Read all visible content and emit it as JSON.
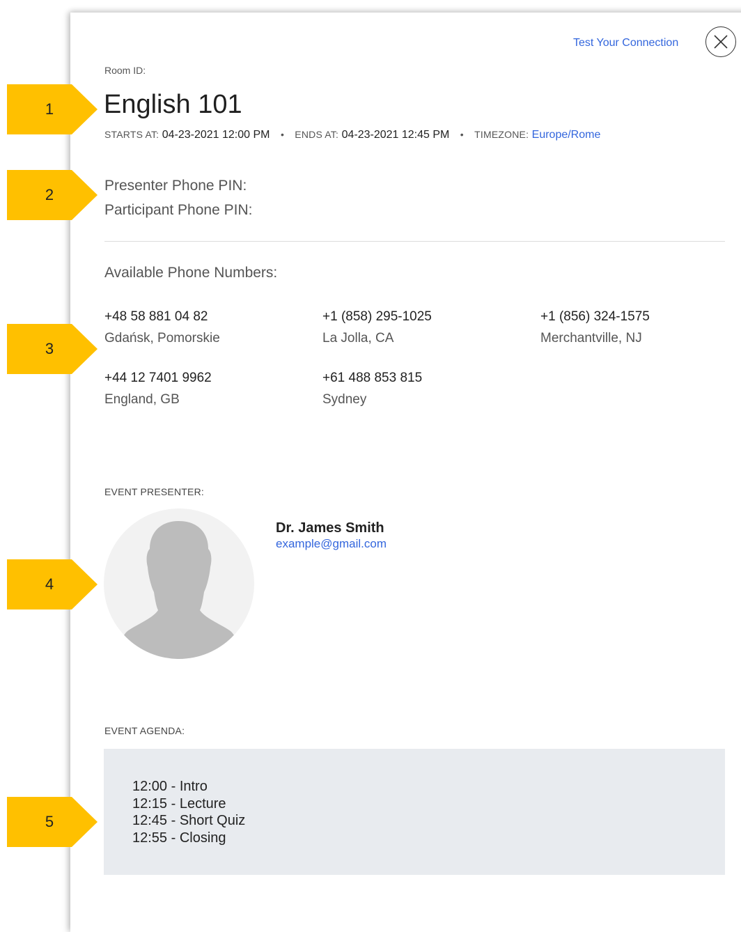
{
  "header": {
    "test_connection": "Test Your Connection",
    "room_id_label": "Room ID:",
    "title": "English 101"
  },
  "schedule": {
    "starts_label": "STARTS AT:",
    "starts_value": "04-23-2021 12:00 PM",
    "ends_label": "ENDS AT:",
    "ends_value": "04-23-2021 12:45 PM",
    "timezone_label": "TIMEZONE:",
    "timezone_value": "Europe/Rome"
  },
  "pins": {
    "presenter": "Presenter Phone PIN:",
    "participant": "Participant Phone PIN:"
  },
  "phones": {
    "heading": "Available Phone Numbers:",
    "items": [
      {
        "number": "+48 58 881 04 82",
        "location": "Gdańsk, Pomorskie"
      },
      {
        "number": "+1 (858) 295-1025",
        "location": "La Jolla, CA"
      },
      {
        "number": "+1 (856) 324-1575",
        "location": "Merchantville, NJ"
      },
      {
        "number": "+44 12 7401 9962",
        "location": "England, GB"
      },
      {
        "number": "+61 488 853 815",
        "location": "Sydney"
      }
    ]
  },
  "presenter": {
    "label": "EVENT PRESENTER:",
    "name": "Dr. James Smith",
    "email": "example@gmail.com"
  },
  "agenda": {
    "label": "EVENT AGENDA:",
    "items": [
      "12:00 - Intro",
      "12:15 - Lecture",
      "12:45 - Short Quiz",
      "12:55 - Closing"
    ]
  },
  "callouts": [
    "1",
    "2",
    "3",
    "4",
    "5"
  ],
  "colors": {
    "link": "#3366dd",
    "callout": "#ffc000",
    "agenda_bg": "#e8ebef",
    "avatar_bg": "#f2f2f2",
    "avatar_fg": "#bcbcbc"
  },
  "icons": {
    "close": "close-icon",
    "avatar": "person-silhouette-icon",
    "callout": "arrow-pentagon"
  }
}
